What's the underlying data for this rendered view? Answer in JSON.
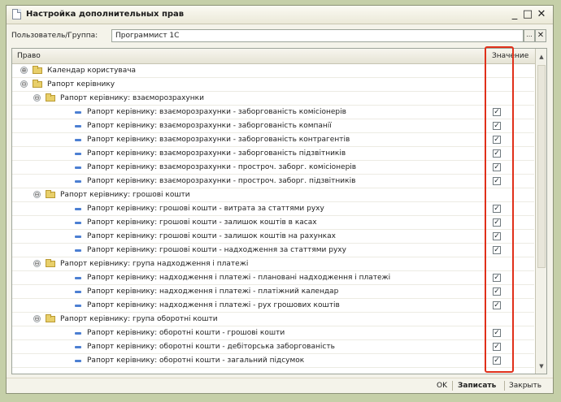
{
  "window": {
    "title": "Настройка дополнительных прав",
    "minimize": "_",
    "maximize": "□",
    "close": "✕"
  },
  "user": {
    "label": "Пользователь/Группа:",
    "value": "Программист 1С",
    "select_btn": "...",
    "clear_btn": "✕"
  },
  "grid": {
    "col_right": "Право",
    "col_value": "Значение",
    "rows": [
      {
        "level": 0,
        "type": "folder",
        "expanded": false,
        "label": "Календар користувача",
        "checked": null
      },
      {
        "level": 0,
        "type": "folder",
        "expanded": true,
        "label": "Рапорт керівнику",
        "checked": null
      },
      {
        "level": 1,
        "type": "folder",
        "expanded": true,
        "label": "Рапорт керівнику: взаєморозрахунки",
        "checked": null
      },
      {
        "level": 2,
        "type": "item",
        "label": "Рапорт керівнику: взаєморозрахунки - заборгованість комісіонерів",
        "checked": true
      },
      {
        "level": 2,
        "type": "item",
        "label": "Рапорт керівнику: взаєморозрахунки - заборгованість компанії",
        "checked": true
      },
      {
        "level": 2,
        "type": "item",
        "label": "Рапорт керівнику: взаєморозрахунки - заборгованість контрагентів",
        "checked": true
      },
      {
        "level": 2,
        "type": "item",
        "label": "Рапорт керівнику: взаєморозрахунки - заборгованість підзвітників",
        "checked": true
      },
      {
        "level": 2,
        "type": "item",
        "label": "Рапорт керівнику: взаєморозрахунки - простроч. заборг. комісіонерів",
        "checked": true
      },
      {
        "level": 2,
        "type": "item",
        "label": "Рапорт керівнику: взаєморозрахунки - простроч. заборг. підзвітників",
        "checked": true
      },
      {
        "level": 1,
        "type": "folder",
        "expanded": true,
        "label": "Рапорт керівнику: грошові кошти",
        "checked": null
      },
      {
        "level": 2,
        "type": "item",
        "label": "Рапорт керівнику: грошові кошти - витрата за статтями руху",
        "checked": true
      },
      {
        "level": 2,
        "type": "item",
        "label": "Рапорт керівнику: грошові кошти - залишок коштів в касах",
        "checked": true
      },
      {
        "level": 2,
        "type": "item",
        "label": "Рапорт керівнику: грошові кошти - залишок коштів на рахунках",
        "checked": true
      },
      {
        "level": 2,
        "type": "item",
        "label": "Рапорт керівнику: грошові кошти - надходження за статтями руху",
        "checked": true
      },
      {
        "level": 1,
        "type": "folder",
        "expanded": true,
        "label": "Рапорт керівнику: група надходження і платежі",
        "checked": null
      },
      {
        "level": 2,
        "type": "item",
        "label": "Рапорт керівнику: надходження і платежі - плановані надходження і платежі",
        "checked": true
      },
      {
        "level": 2,
        "type": "item",
        "label": "Рапорт керівнику: надходження і платежі - платіжний календар",
        "checked": true
      },
      {
        "level": 2,
        "type": "item",
        "label": "Рапорт керівнику: надходження і платежі - рух грошових коштів",
        "checked": true
      },
      {
        "level": 1,
        "type": "folder",
        "expanded": true,
        "label": "Рапорт керівнику: група оборотні кошти",
        "checked": null
      },
      {
        "level": 2,
        "type": "item",
        "label": "Рапорт керівнику: оборотні кошти - грошові кошти",
        "checked": true
      },
      {
        "level": 2,
        "type": "item",
        "label": "Рапорт керівнику: оборотні кошти - дебіторська заборгованість",
        "checked": true
      },
      {
        "level": 2,
        "type": "item",
        "label": "Рапорт керівнику: оборотні кошти - загальний підсумок",
        "checked": true
      }
    ]
  },
  "footer": {
    "ok": "OK",
    "save": "Записать",
    "close": "Закрыть"
  },
  "icons": {
    "expand": "⊕",
    "collapse": "⊖",
    "check": "✓",
    "up": "▲",
    "down": "▼"
  },
  "colors": {
    "highlight": "#e0301a",
    "item_dash": "#4c7fd2",
    "folder": "#e8cf6a"
  }
}
